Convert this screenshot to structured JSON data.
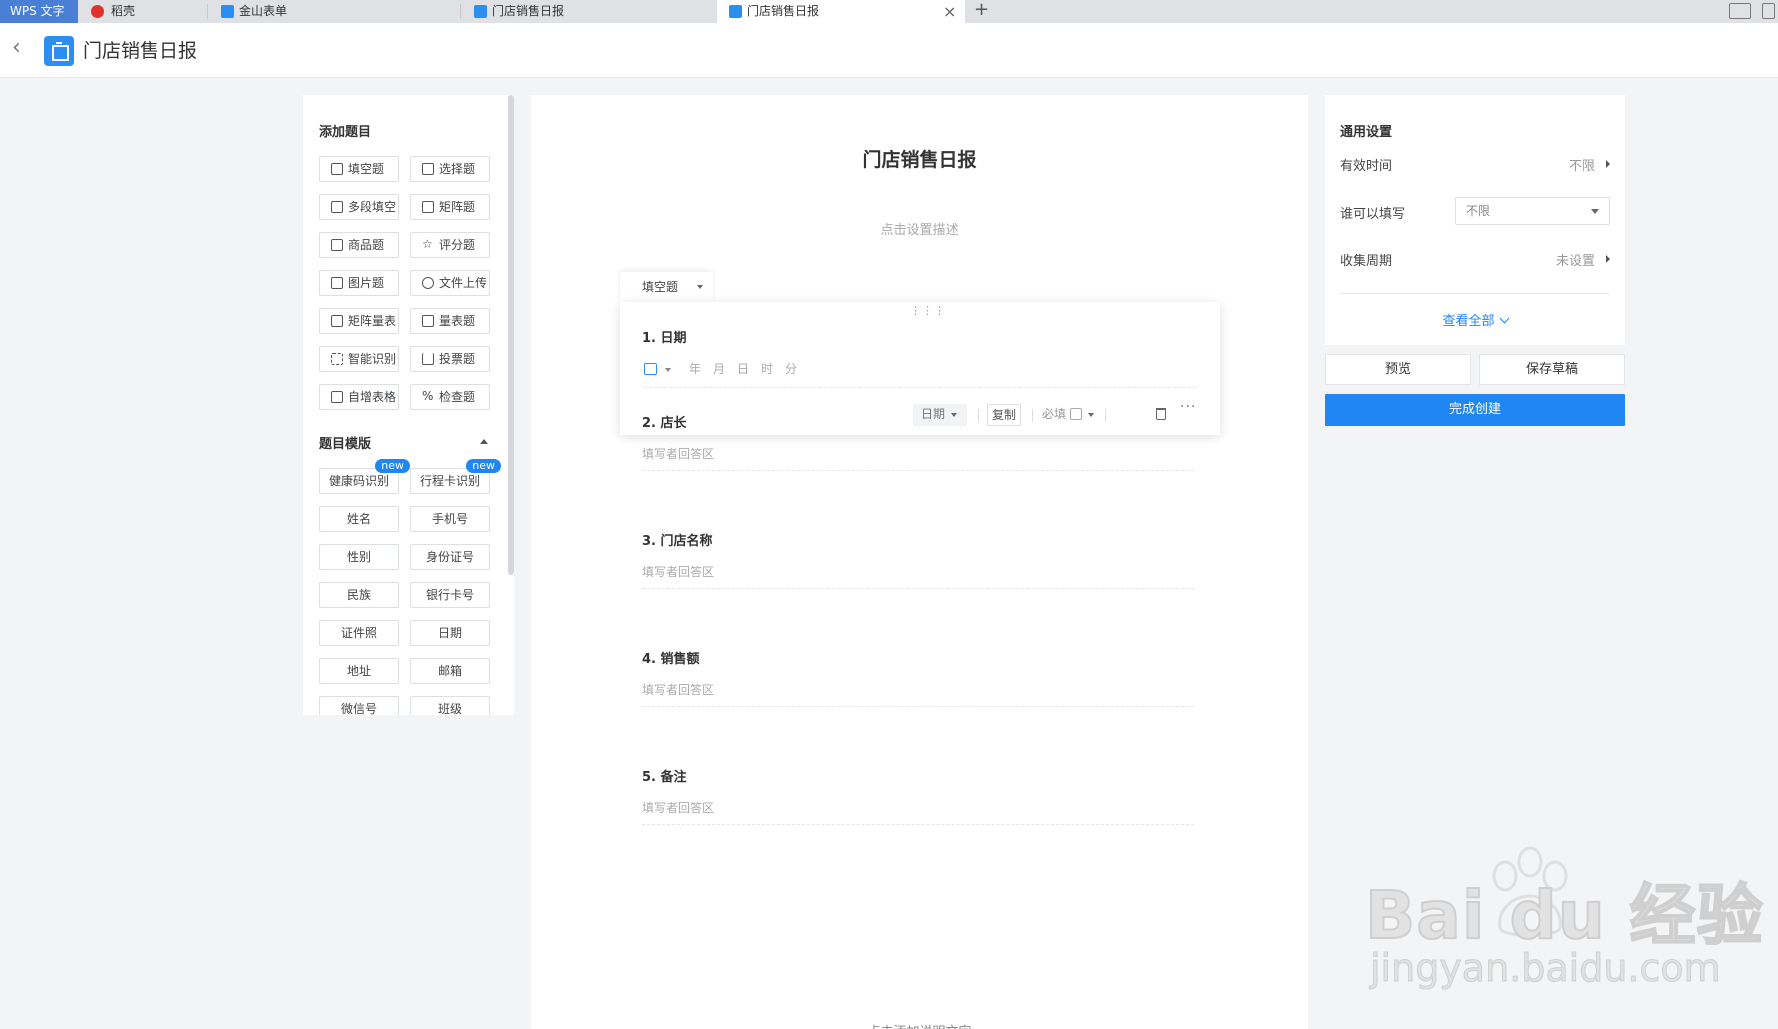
{
  "tabs": {
    "wps": "WPS 文字",
    "docer": "稻壳",
    "forms": "金山表单",
    "report_inactive": "门店销售日报",
    "report_active": "门店销售日报",
    "close": "×",
    "add": "+"
  },
  "header": {
    "back": "‹",
    "title": "门店销售日报"
  },
  "left_panel": {
    "add_title": "添加题目",
    "question_types": [
      "填空题",
      "选择题",
      "多段填空",
      "矩阵题",
      "商品题",
      "评分题",
      "图片题",
      "文件上传",
      "矩阵量表",
      "量表题",
      "智能识别",
      "投票题",
      "自增表格",
      "检查题"
    ],
    "template_title": "题目模版",
    "templates": [
      "健康码识别",
      "行程卡识别",
      "姓名",
      "手机号",
      "性别",
      "身份证号",
      "民族",
      "银行卡号",
      "证件照",
      "日期",
      "地址",
      "邮箱",
      "微信号",
      "班级"
    ],
    "badge": "new"
  },
  "form": {
    "title": "门店销售日报",
    "description": "点击设置描述",
    "question_type": "填空题",
    "drag": "⋮⋮⋮",
    "questions": [
      {
        "num": "1.",
        "title": "日期"
      },
      {
        "num": "2.",
        "title": "店长",
        "placeholder": "填写者回答区"
      },
      {
        "num": "3.",
        "title": "门店名称",
        "placeholder": "填写者回答区"
      },
      {
        "num": "4.",
        "title": "销售额",
        "placeholder": "填写者回答区"
      },
      {
        "num": "5.",
        "title": "备注",
        "placeholder": "填写者回答区"
      }
    ],
    "date_parts": [
      "年",
      "月",
      "日",
      "时",
      "分"
    ],
    "toolbar": {
      "type": "日期",
      "copy": "复制",
      "required": "必填",
      "more": "···"
    },
    "footer_clipped": "点击添加说明文字"
  },
  "settings": {
    "title": "通用设置",
    "valid_time_label": "有效时间",
    "valid_time_value": "不限",
    "who_can_fill_label": "谁可以填写",
    "who_can_fill_value": "不限",
    "collect_cycle_label": "收集周期",
    "collect_cycle_value": "未设置",
    "view_all": "查看全部",
    "preview": "预览",
    "save_draft": "保存草稿",
    "finish": "完成创建"
  },
  "watermark": {
    "brand": "Bai du 经验",
    "url": "jingyan.baidu.com"
  },
  "colors": {
    "accent": "#1f86f2",
    "wps_tab": "#4a7fd6"
  }
}
